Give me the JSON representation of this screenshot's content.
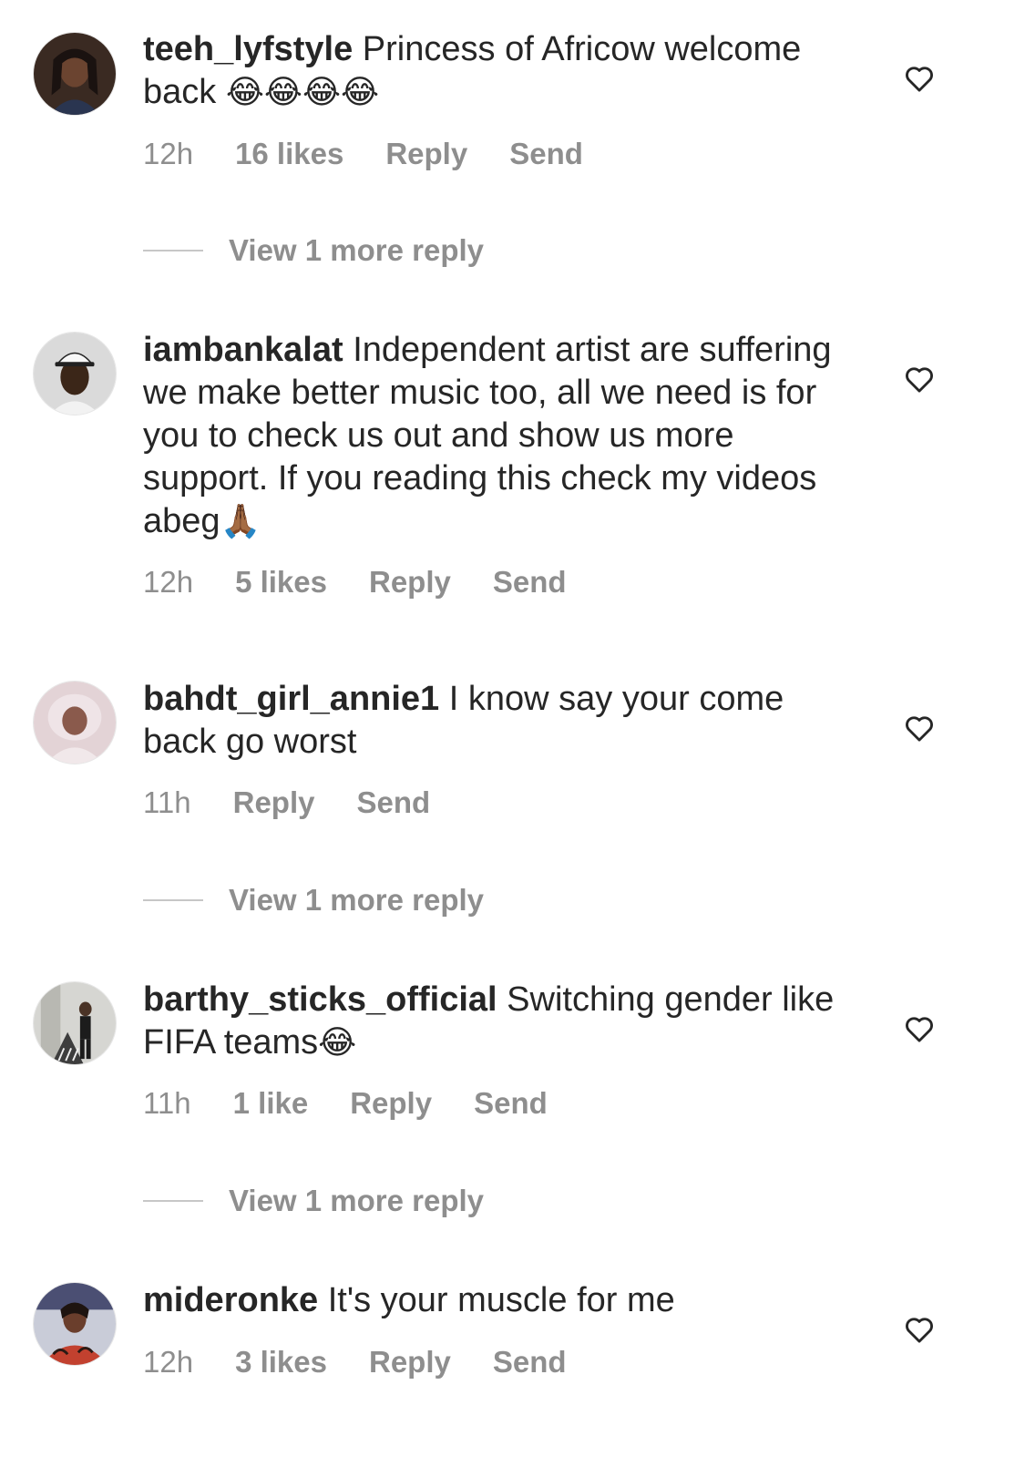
{
  "comments": [
    {
      "username": "teeh_lyfstyle",
      "text": "Princess of Africow welcome back",
      "emoji": "😂😂😂😂",
      "time": "12h",
      "likes": "16 likes",
      "reply": "Reply",
      "send": "Send",
      "view_more": "View 1 more reply"
    },
    {
      "username": "iambankalat",
      "text": "Independent artist are suffering we make better music too, all we need is for you to check us out and show us more support. If you reading this check my videos  abeg",
      "emoji": "🙏🏾",
      "time": "12h",
      "likes": "5 likes",
      "reply": "Reply",
      "send": "Send"
    },
    {
      "username": "bahdt_girl_annie1",
      "text": "I know say your come back go worst",
      "time": "11h",
      "reply": "Reply",
      "send": "Send",
      "view_more": "View 1 more reply"
    },
    {
      "username": "barthy_sticks_official",
      "text": "Switching gender like FIFA teams",
      "emoji": "😂",
      "time": "11h",
      "likes": "1 like",
      "reply": "Reply",
      "send": "Send",
      "view_more": "View 1 more reply"
    },
    {
      "username": "mideronke",
      "text": "It's your muscle for me",
      "time": "12h",
      "likes": "3 likes",
      "reply": "Reply",
      "send": "Send"
    }
  ],
  "icons": {
    "like": "heart-outline-icon"
  },
  "colors": {
    "text": "#262626",
    "secondary": "#8e8e8e",
    "divider": "#c7c7c7"
  }
}
